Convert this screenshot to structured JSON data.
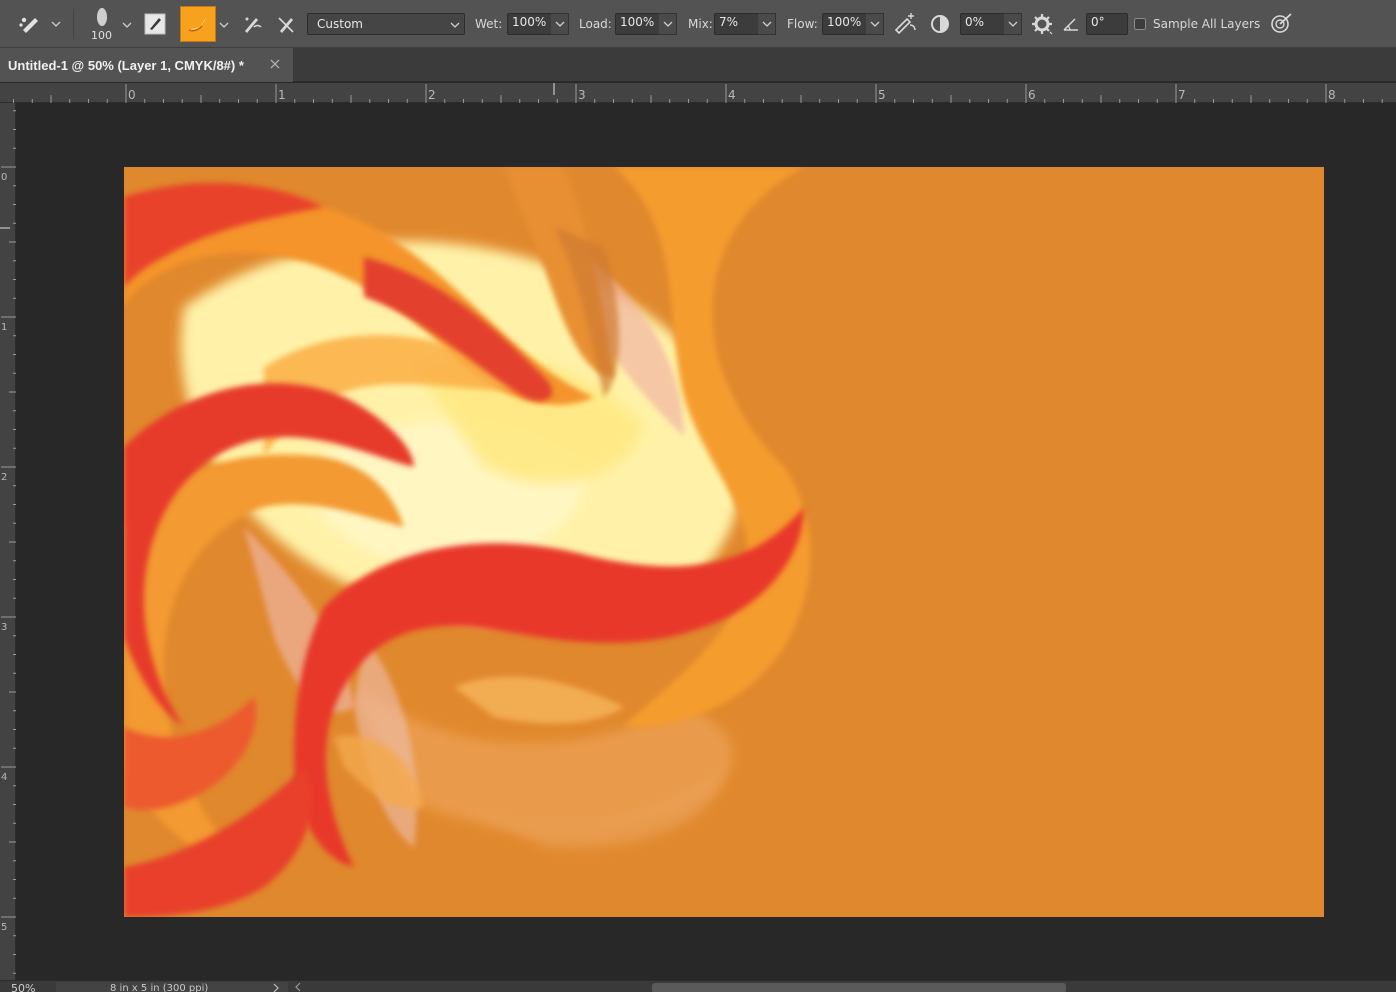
{
  "options_bar": {
    "brush_size": "100",
    "brush_preset": "Custom",
    "wet_label": "Wet:",
    "wet_value": "100%",
    "load_label": "Load:",
    "load_value": "100%",
    "mix_label": "Mix:",
    "mix_value": "7%",
    "flow_label": "Flow:",
    "flow_value": "100%",
    "smoothing_value": "0%",
    "angle_value": "0°",
    "sample_all_layers_label": "Sample All Layers",
    "sample_all_layers_checked": false,
    "current_color": "#f7a21c"
  },
  "document_tab": {
    "title": "Untitled-1 @ 50% (Layer 1, CMYK/8#) *"
  },
  "rulers": {
    "horizontal": [
      "0",
      "1",
      "2",
      "3",
      "4",
      "5",
      "6",
      "7",
      "8"
    ],
    "vertical": [
      "0",
      "1",
      "2",
      "3",
      "4",
      "5"
    ]
  },
  "canvas": {
    "background_color": "#e0882d",
    "stroke_colors": [
      "#e83a2a",
      "#f59a2a",
      "#fff0a0",
      "#f0a8a0"
    ]
  },
  "status_bar": {
    "zoom": "50%",
    "doc_info": "8 in x 5 in (300 ppi)"
  },
  "icons": [
    "mixer-brush-tool-icon",
    "clean-brush-icon",
    "brush-load-icon",
    "load-brush-after-stroke-icon",
    "clean-brush-after-stroke-icon",
    "airbrush-icon",
    "pressure-size-icon",
    "settings-gear-icon",
    "angle-icon",
    "pressure-pen-icon"
  ]
}
